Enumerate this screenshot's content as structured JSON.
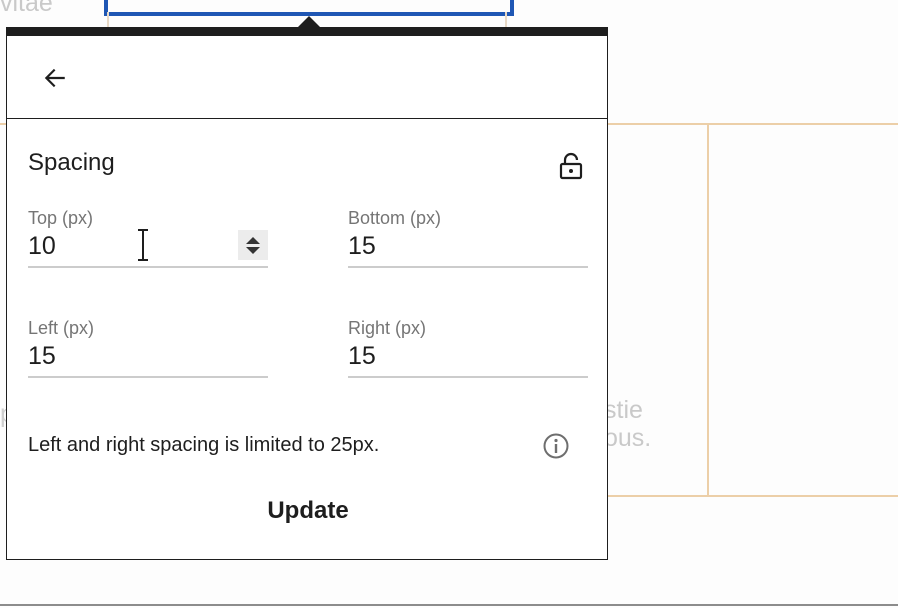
{
  "background": {
    "top_text": "vitae",
    "right_text_line1": "stie",
    "right_text_line2": "ous.",
    "left_fragment": "p"
  },
  "popover": {
    "back_icon": "arrow-left-icon",
    "section_title": "Spacing",
    "lock_icon": "lock-icon",
    "fields": {
      "top": {
        "label": "Top (px)",
        "value": "10"
      },
      "bottom": {
        "label": "Bottom (px)",
        "value": "15"
      },
      "left": {
        "label": "Left (px)",
        "value": "15"
      },
      "right": {
        "label": "Right (px)",
        "value": "15"
      }
    },
    "note": "Left and right spacing is limited to 25px.",
    "info_icon": "info-icon",
    "update_label": "Update"
  },
  "colors": {
    "selection_blue": "#1f57b4",
    "border_dark": "#1e1e1e",
    "guide_orange": "#eccfa8",
    "label_gray": "#757575"
  }
}
